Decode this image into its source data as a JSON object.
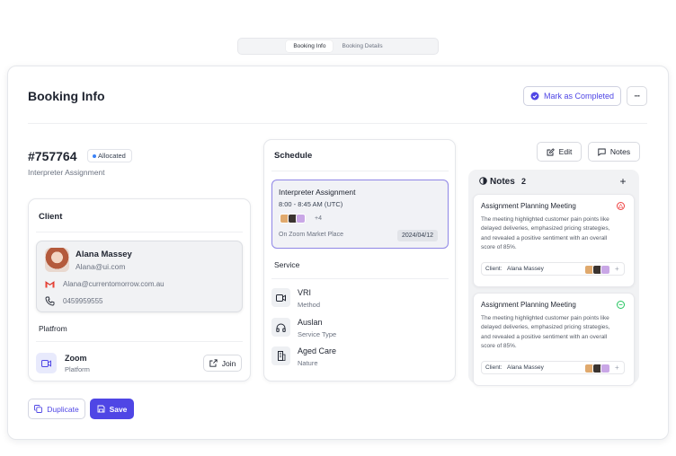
{
  "tabs": [
    {
      "label": "Booking Info",
      "active": true
    },
    {
      "label": "Booking Details",
      "active": false
    }
  ],
  "header": {
    "title": "Booking Info",
    "complete_label": "Mark as Completed",
    "more_label": "···"
  },
  "booking": {
    "id": "#757764",
    "status": "Allocated",
    "type": "Interpreter Assignment"
  },
  "client": {
    "section_title": "Client",
    "name": "Alana Massey",
    "email": "Alana@ui.com",
    "gmail": "Alana@currentomorrow.com.au",
    "phone": "0459959555",
    "platform_label": "Platfrom",
    "platform_name": "Zoom",
    "platform_sub": "Platform",
    "join_label": "Join"
  },
  "actions": {
    "duplicate": "Duplicate",
    "save": "Save"
  },
  "schedule": {
    "title": "Schedule",
    "appointment": {
      "title": "Interpreter Assignment",
      "time": "8:00 - 8:45 AM (UTC)",
      "extra": "+4",
      "place": "On Zoom Market Place",
      "date": "2024/04/12"
    },
    "service_label": "Service",
    "services": [
      {
        "name": "VRI",
        "sub": "Method",
        "icon": "video-icon"
      },
      {
        "name": "Auslan",
        "sub": "Service Type",
        "icon": "headphones-icon"
      },
      {
        "name": "Aged Care",
        "sub": "Nature",
        "icon": "building-icon"
      }
    ]
  },
  "toolbar": {
    "edit": "Edit",
    "notes": "Notes"
  },
  "notes": {
    "title": "Notes",
    "count": "2",
    "add": "+",
    "items": [
      {
        "title": "Assignment Planning Meeting",
        "body": "The meeting highlighted customer pain points like delayed deliveries, emphasized pricing strategies, and revealed a positive sentiment with an overall score of 85%.",
        "client_label": "Client:",
        "client_name": "Alana Massey",
        "add": "+",
        "status": "warning",
        "status_color": "#ef4444"
      },
      {
        "title": "Assignment Planning Meeting",
        "body": "The meeting highlighted customer pain points like delayed deliveries, emphasized pricing strategies, and revealed a positive sentiment with an overall score of 85%.",
        "client_label": "Client:",
        "client_name": "Alana Massey",
        "add": "+",
        "status": "ok",
        "status_color": "#22c55e"
      }
    ]
  },
  "colors": {
    "accent": "#4f46e5",
    "status_dot": "#3b82f6"
  }
}
